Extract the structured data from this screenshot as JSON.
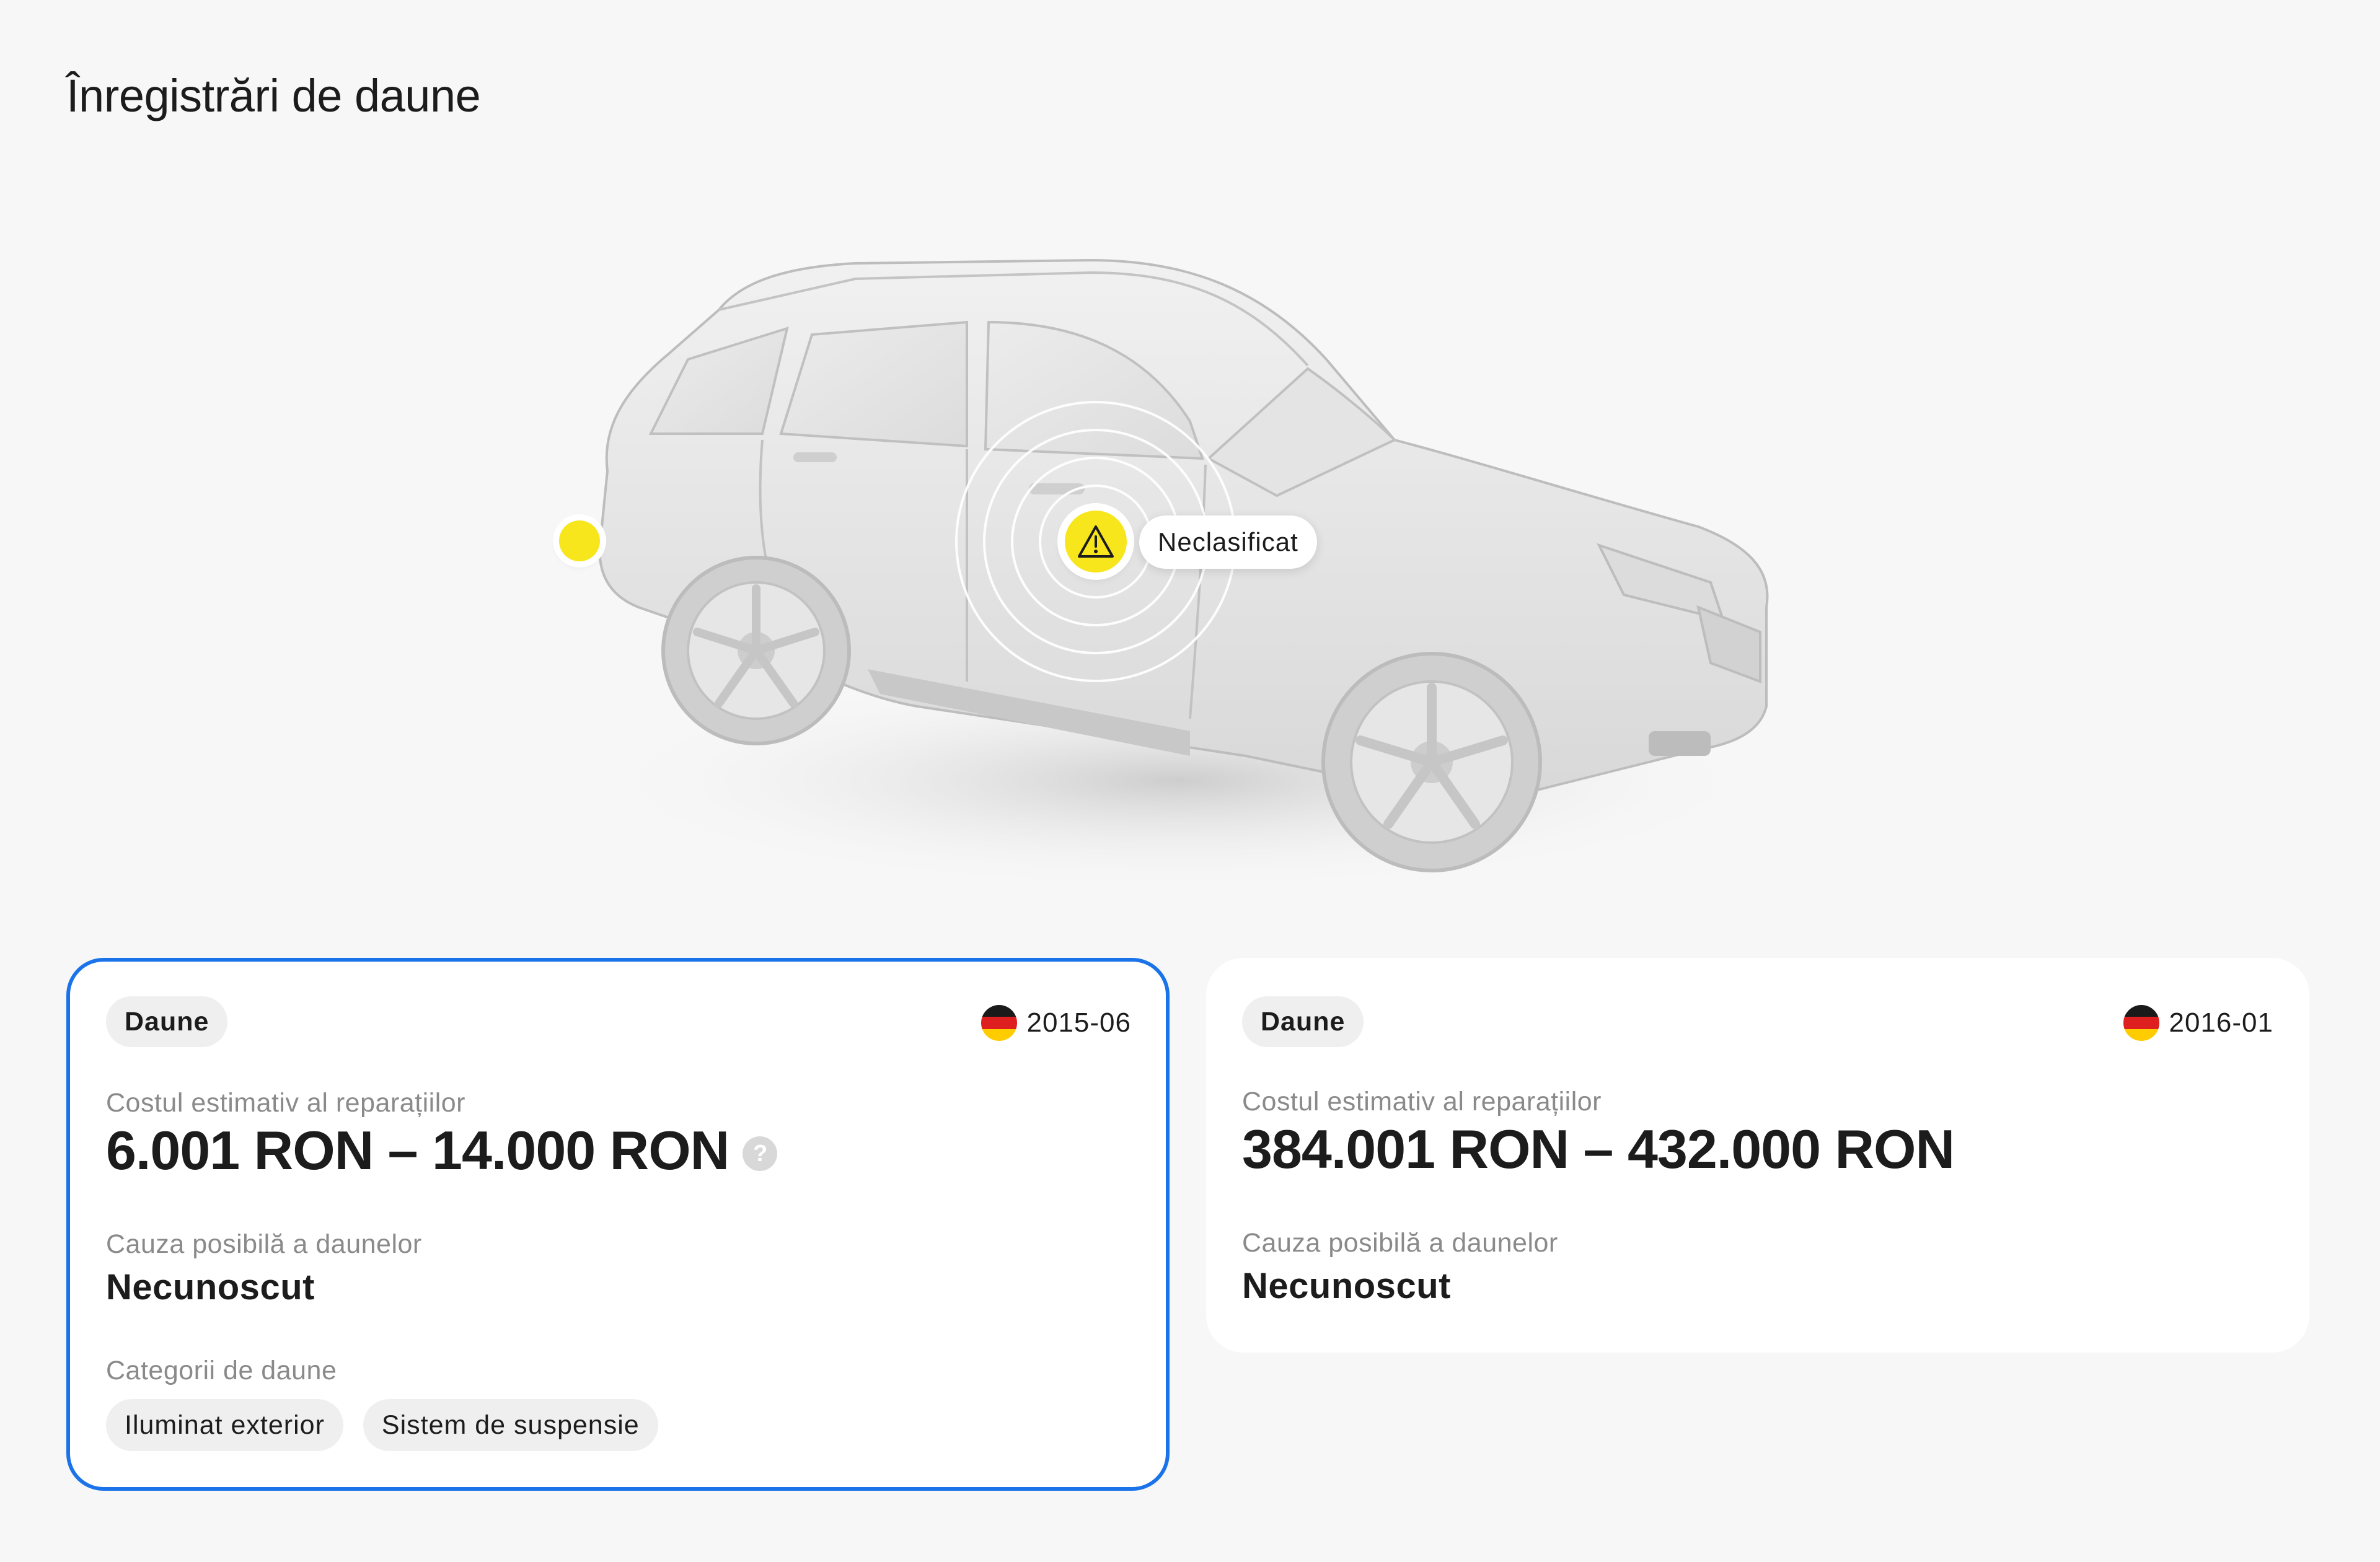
{
  "page": {
    "title": "Înregistrări de daune"
  },
  "car_view": {
    "marker_label": "Neclasificat",
    "warning_icon": "warning-triangle-icon",
    "marker_color": "#f7e61c"
  },
  "records": [
    {
      "badge": "Daune",
      "country_flag": "germany-flag-icon",
      "date": "2015-06",
      "cost_label": "Costul estimativ al reparațiilor",
      "cost_value": "6.001 RON – 14.000 RON",
      "help_icon": "?",
      "cause_label": "Cauza posibilă a daunelor",
      "cause_value": "Necunoscut",
      "categories_label": "Categorii de daune",
      "categories": [
        "Iluminat exterior",
        "Sistem de suspensie"
      ],
      "selected": true
    },
    {
      "badge": "Daune",
      "country_flag": "germany-flag-icon",
      "date": "2016-01",
      "cost_label": "Costul estimativ al reparațiilor",
      "cost_value": "384.001 RON – 432.000 RON",
      "cause_label": "Cauza posibilă a daunelor",
      "cause_value": "Necunoscut",
      "selected": false
    }
  ],
  "colors": {
    "accent": "#1a73e8",
    "marker": "#f7e61c",
    "background": "#f7f7f7"
  }
}
